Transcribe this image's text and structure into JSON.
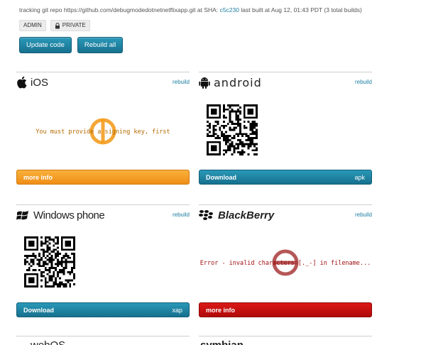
{
  "header": {
    "info_prefix": "tracking git repo https://github.com/debugmodedotnetnetflixapp.git at SHA:",
    "sha": "c5c230",
    "info_suffix": "last built at Aug 12, 01:43 PDT (3 total builds)",
    "badge_admin": "ADMIN",
    "badge_private": "PRIVATE",
    "update_label": "Update code",
    "rebuild_all_label": "Rebuild all"
  },
  "cards": {
    "ios": {
      "name": "iOS",
      "rebuild": "rebuild",
      "message": "You must provide a signing key, first",
      "button": "more info",
      "ext": ""
    },
    "android": {
      "name": "android",
      "rebuild": "rebuild",
      "button": "Download",
      "ext": "apk"
    },
    "winphone": {
      "name": "Windows phone",
      "rebuild": "rebuild",
      "button": "Download",
      "ext": "xap"
    },
    "blackberry": {
      "name": "BlackBerry",
      "rebuild": "rebuild",
      "message": "Error - invalid characters [._-] in filename...",
      "button": "more info",
      "ext": ""
    },
    "webos": {
      "name": "webOS"
    },
    "symbian": {
      "name": "symbian"
    }
  },
  "colors": {
    "teal": "#1e87a7",
    "orange": "#f39c1f",
    "red": "#c40f0f",
    "link": "#1d7ea0"
  }
}
